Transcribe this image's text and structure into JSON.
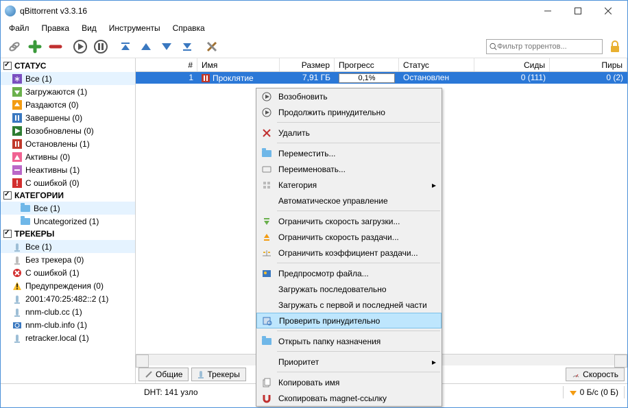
{
  "window": {
    "title": "qBittorrent v3.3.16"
  },
  "menu": {
    "file": "Файл",
    "edit": "Правка",
    "view": "Вид",
    "tools": "Инструменты",
    "help": "Справка"
  },
  "toolbar": {
    "search_placeholder": "Фильтр торрентов..."
  },
  "sidebar": {
    "status": {
      "title": "СТАТУС",
      "items": [
        {
          "label": "Все (1)"
        },
        {
          "label": "Загружаются (1)"
        },
        {
          "label": "Раздаются (0)"
        },
        {
          "label": "Завершены (0)"
        },
        {
          "label": "Возобновлены (0)"
        },
        {
          "label": "Остановлены (1)"
        },
        {
          "label": "Активны (0)"
        },
        {
          "label": "Неактивны (1)"
        },
        {
          "label": "С ошибкой (0)"
        }
      ]
    },
    "categories": {
      "title": "КАТЕГОРИИ",
      "items": [
        {
          "label": "Все (1)"
        },
        {
          "label": "Uncategorized (1)"
        }
      ]
    },
    "trackers": {
      "title": "ТРЕКЕРЫ",
      "items": [
        {
          "label": "Все (1)"
        },
        {
          "label": "Без трекера (0)"
        },
        {
          "label": "С ошибкой (1)"
        },
        {
          "label": "Предупреждения (0)"
        },
        {
          "label": "2001:470:25:482::2 (1)"
        },
        {
          "label": "nnm-club.cc (1)"
        },
        {
          "label": "nnm-club.info (1)"
        },
        {
          "label": "retracker.local (1)"
        }
      ]
    }
  },
  "grid": {
    "headers": {
      "num": "#",
      "name": "Имя",
      "size": "Размер",
      "progress": "Прогресс",
      "status": "Статус",
      "seeds": "Сиды",
      "peers": "Пиры"
    },
    "rows": [
      {
        "num": "1",
        "name": "Проклятие",
        "size": "7,91 ГБ",
        "progress": "0,1%",
        "status": "Остановлен",
        "seeds": "0 (111)",
        "peers": "0 (2)"
      }
    ]
  },
  "tabs": {
    "general": "Общие",
    "trackers": "Трекеры",
    "speed": "Скорость"
  },
  "statusbar": {
    "dht": "DHT: 141 узло",
    "down": "0 Б/с (0 Б)"
  },
  "ctx": {
    "resume": "Возобновить",
    "force_resume": "Продолжить принудительно",
    "delete": "Удалить",
    "move": "Переместить...",
    "rename": "Переименовать...",
    "category": "Категория",
    "auto_manage": "Автоматическое управление",
    "limit_dl": "Ограничить скорость загрузки...",
    "limit_up": "Ограничить скорость раздачи...",
    "limit_ratio": "Ограничить коэффициент раздачи...",
    "preview": "Предпросмотр файла...",
    "sequential": "Загружать последовательно",
    "first_last": "Загружать с первой и последней части",
    "force_recheck": "Проверить принудительно",
    "open_folder": "Открыть папку назначения",
    "priority": "Приоритет",
    "copy_name": "Копировать имя",
    "copy_magnet": "Скопировать magnet-ссылку"
  }
}
